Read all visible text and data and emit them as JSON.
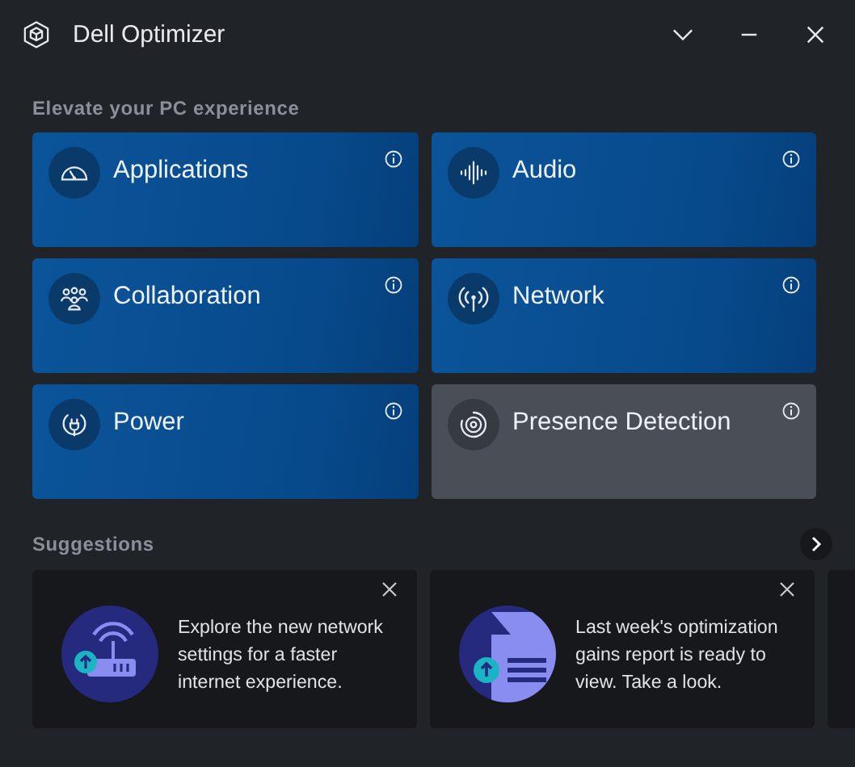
{
  "window": {
    "title": "Dell Optimizer"
  },
  "section_title": "Elevate your PC experience",
  "tiles": [
    {
      "label": "Applications",
      "kind": "gauge",
      "disabled": false
    },
    {
      "label": "Audio",
      "kind": "wave",
      "disabled": false
    },
    {
      "label": "Collaboration",
      "kind": "people",
      "disabled": false
    },
    {
      "label": "Network",
      "kind": "antenna",
      "disabled": false
    },
    {
      "label": "Power",
      "kind": "plug",
      "disabled": false
    },
    {
      "label": "Presence Detection",
      "kind": "target",
      "disabled": true
    }
  ],
  "suggestions": {
    "title": "Suggestions",
    "cards": [
      {
        "kind": "router",
        "text": "Explore the new network settings for a faster internet experience."
      },
      {
        "kind": "report",
        "text": "Last week's optimization gains report is ready to view. Take a look."
      }
    ]
  }
}
